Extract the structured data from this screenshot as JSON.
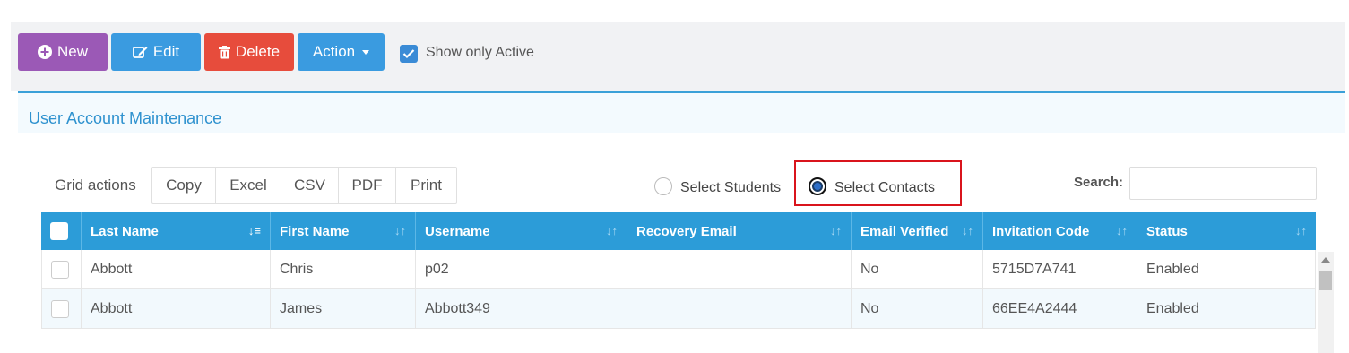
{
  "toolbar": {
    "new_label": "New",
    "edit_label": "Edit",
    "delete_label": "Delete",
    "action_label": "Action",
    "show_active_label": "Show only Active",
    "show_active_checked": true
  },
  "panel": {
    "title": "User Account Maintenance"
  },
  "grid": {
    "actions_label": "Grid actions",
    "buttons": [
      "Copy",
      "Excel",
      "CSV",
      "PDF",
      "Print"
    ]
  },
  "select": {
    "students_label": "Select Students",
    "contacts_label": "Select Contacts",
    "selected": "contacts"
  },
  "search": {
    "label": "Search:",
    "value": ""
  },
  "table": {
    "columns": [
      "Last Name",
      "First Name",
      "Username",
      "Recovery Email",
      "Email Verified",
      "Invitation Code",
      "Status"
    ],
    "rows": [
      [
        "Abbott",
        "Chris",
        "p02",
        "",
        "No",
        "5715D7A741",
        "Enabled"
      ],
      [
        "Abbott",
        "James",
        "Abbott349",
        "",
        "No",
        "66EE4A2444",
        "Enabled"
      ]
    ]
  },
  "colors": {
    "purple": "#9b59b6",
    "blue": "#3a9be0",
    "red": "#e74c3c",
    "header": "#2c9cd8"
  }
}
